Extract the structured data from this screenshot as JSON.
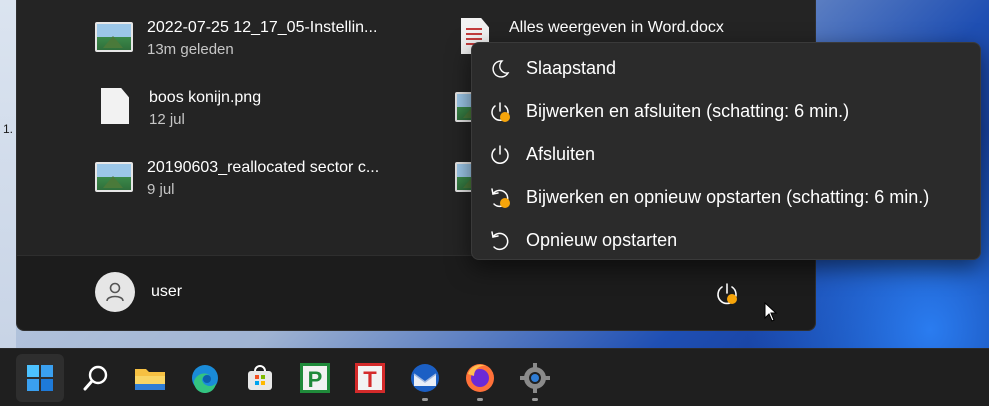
{
  "desktop": {
    "left_strip_label": "1."
  },
  "recent_files": [
    {
      "name": "2022-07-25 12_17_05-Instellin...",
      "date": "13m geleden",
      "icon": "image-file-icon"
    },
    {
      "name": "Alles weergeven in Word.docx",
      "date": "",
      "icon": "word-document-icon"
    },
    {
      "name": "boos konijn.png",
      "date": "12 jul",
      "icon": "document-file-icon"
    },
    {
      "name": "20190603_reallocated sector c...",
      "date": "9 jul",
      "icon": "image-file-icon"
    }
  ],
  "user": {
    "name": "user"
  },
  "power_menu": {
    "items": [
      {
        "label": "Slaapstand",
        "icon": "moon-icon"
      },
      {
        "label": "Bijwerken en afsluiten (schatting: 6 min.)",
        "icon": "update-shutdown-icon"
      },
      {
        "label": "Afsluiten",
        "icon": "power-icon"
      },
      {
        "label": "Bijwerken en opnieuw opstarten (schatting: 6 min.)",
        "icon": "update-restart-icon"
      },
      {
        "label": "Opnieuw opstarten",
        "icon": "restart-icon"
      }
    ]
  },
  "colors": {
    "update_badge": "#f7a50a",
    "panel_bg": "#242424",
    "menu_bg": "#2b2b2b",
    "taskbar_bg": "#1f1f1f"
  },
  "taskbar": {
    "items": [
      {
        "icon": "windows-start-icon",
        "running": false,
        "active": true
      },
      {
        "icon": "search-icon",
        "running": false,
        "active": false
      },
      {
        "icon": "file-explorer-icon",
        "running": false,
        "active": false
      },
      {
        "icon": "edge-browser-icon",
        "running": false,
        "active": false
      },
      {
        "icon": "microsoft-store-icon",
        "running": false,
        "active": false
      },
      {
        "icon": "project-app-icon",
        "running": false,
        "active": false
      },
      {
        "icon": "text-app-icon",
        "running": false,
        "active": false
      },
      {
        "icon": "thunderbird-icon",
        "running": true,
        "active": false
      },
      {
        "icon": "firefox-icon",
        "running": true,
        "active": false
      },
      {
        "icon": "settings-gear-icon",
        "running": true,
        "active": false
      }
    ],
    "project_letter": "P",
    "text_letter": "T"
  }
}
